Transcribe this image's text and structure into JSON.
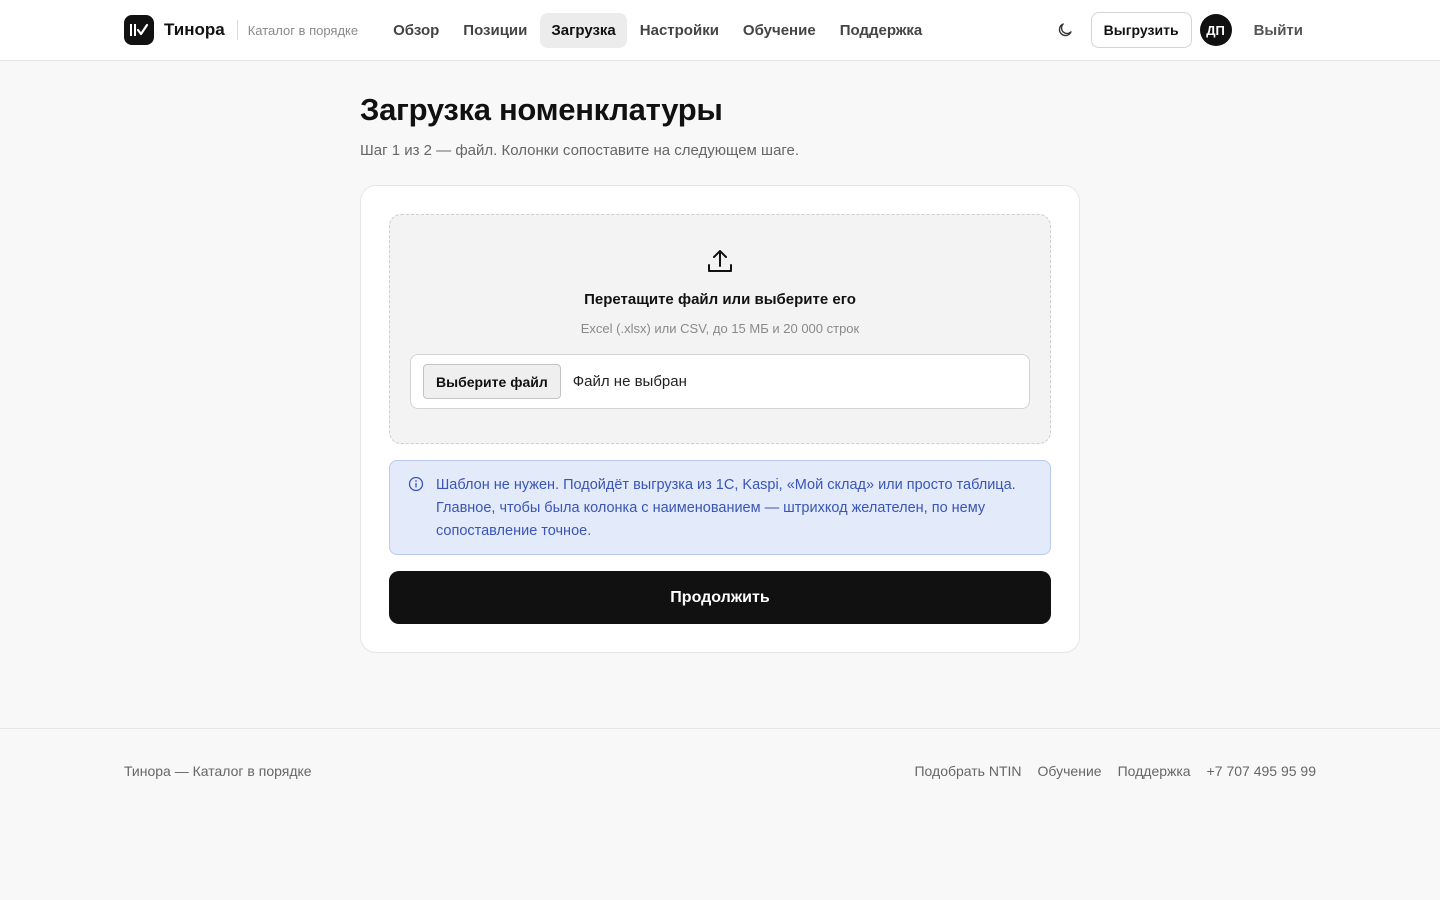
{
  "header": {
    "brand": "Тинора",
    "tagline": "Каталог в порядке",
    "nav": [
      {
        "label": "Обзор"
      },
      {
        "label": "Позиции"
      },
      {
        "label": "Загрузка"
      },
      {
        "label": "Настройки"
      },
      {
        "label": "Обучение"
      },
      {
        "label": "Поддержка"
      }
    ],
    "active_nav": "Загрузка",
    "export_label": "Выгрузить",
    "avatar_initials": "ДП",
    "logout_label": "Выйти"
  },
  "main": {
    "title": "Загрузка номенклатуры",
    "subtitle": "Шаг 1 из 2 — файл. Колонки сопоставите на следующем шаге.",
    "dropzone": {
      "icon": "upload-icon",
      "title": "Перетащите файл или выберите его",
      "hint": "Excel (.xlsx) или CSV, до 15 МБ и 20 000 строк",
      "choose_button": "Выберите файл",
      "file_status": "Файл не выбран"
    },
    "info": {
      "icon": "info-icon",
      "text": "Шаблон не нужен. Подойдёт выгрузка из 1С, Kaspi, «Мой склад» или просто таблица. Главное, чтобы была колонка с наименованием — штрихкод желателен, по нему сопоставление точное."
    },
    "continue_label": "Продолжить"
  },
  "footer": {
    "copy": "Тинора — Каталог в порядке",
    "links": [
      {
        "label": "Подобрать NTIN"
      },
      {
        "label": "Обучение"
      },
      {
        "label": "Поддержка"
      },
      {
        "label": "+7 707 495 95 99"
      }
    ]
  },
  "colors": {
    "accent": "#111111",
    "info_bg": "#e3ebfb",
    "info_text": "#3a55b5"
  }
}
